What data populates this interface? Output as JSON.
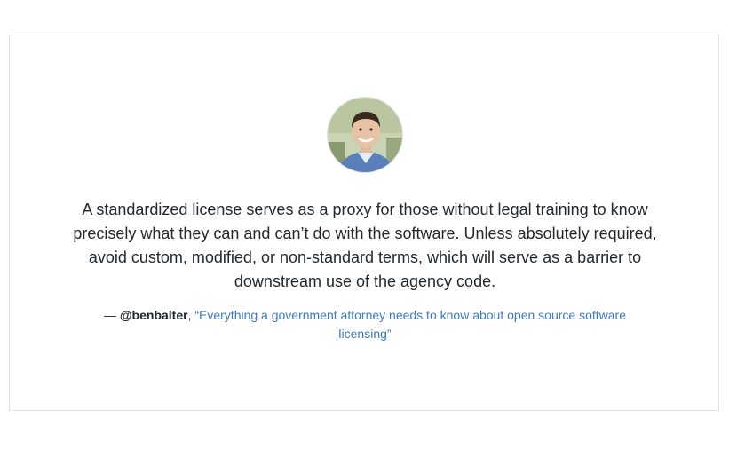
{
  "testimonial": {
    "quote": "A standardized license serves as a proxy for those without legal training to know precisely what they can and can’t do with the software. Unless absolutely required, avoid custom, modified, or non-standard terms, which will serve as a barrier to downstream use of the agency code.",
    "attribution_prefix": "— ",
    "author_handle": "@benbalter",
    "separator": ", ",
    "source_title": "“Everything a government attorney needs to know about open source software licensing”"
  },
  "colors": {
    "text": "#24292e",
    "link": "#4078c0",
    "border": "#e1e4e8"
  },
  "icons": {
    "avatar": "person-photo"
  }
}
